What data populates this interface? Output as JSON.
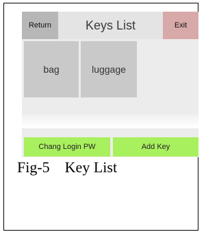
{
  "header": {
    "return_label": "Return",
    "title": "Keys List",
    "exit_label": "Exit"
  },
  "keys": [
    {
      "label": "bag"
    },
    {
      "label": "luggage"
    }
  ],
  "actions": {
    "change_pw_label": "Chang Login PW",
    "add_key_label": "Add Key"
  },
  "caption": "Fig-5    Key List",
  "colors": {
    "return_bg": "#b7b7b7",
    "exit_bg": "#d8a9a9",
    "tile_bg": "#c9c9c9",
    "action_bg": "#a9f05e"
  }
}
